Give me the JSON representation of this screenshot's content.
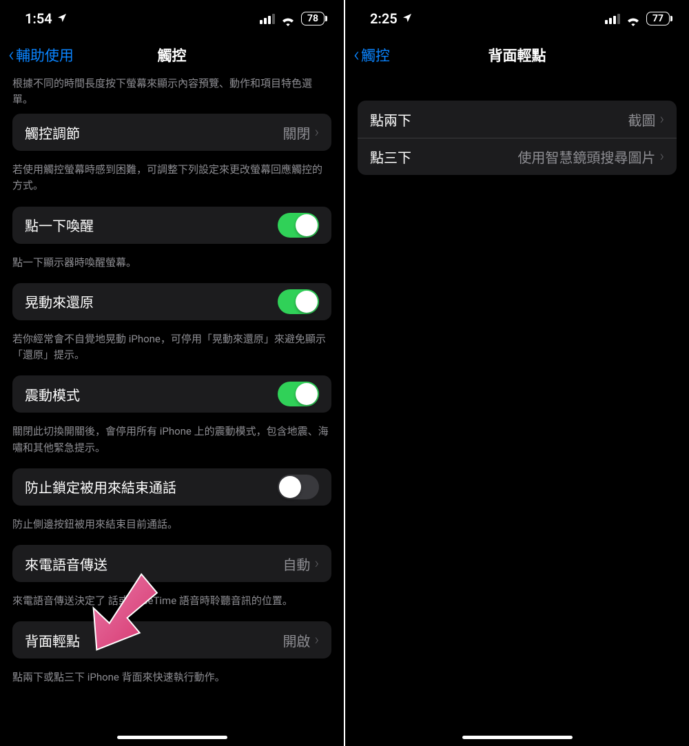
{
  "left": {
    "status": {
      "time": "1:54",
      "battery": "78"
    },
    "nav": {
      "back": "輔助使用",
      "title": "觸控"
    },
    "partialFooter": "根據不同的時間長度按下螢幕來顯示內容預覽、動作和項目特色選單。",
    "rows": {
      "touchAccommodations": {
        "label": "觸控調節",
        "value": "關閉",
        "footer": "若使用觸控螢幕時感到困難，可調整下列設定來更改螢幕回應觸控的方式。"
      },
      "tapToWake": {
        "label": "點一下喚醒",
        "footer": "點一下顯示器時喚醒螢幕。"
      },
      "shakeToUndo": {
        "label": "晃動來還原",
        "footer": "若你經常會不自覺地晃動 iPhone，可停用「晃動來還原」來避免顯示「還原」提示。"
      },
      "vibration": {
        "label": "震動模式",
        "footer": "關閉此切換開關後，會停用所有 iPhone 上的震動模式，包含地震、海嘯和其他緊急提示。"
      },
      "preventLock": {
        "label": "防止鎖定被用來結束通話",
        "footer": "防止側邊按鈕被用來結束目前通話。"
      },
      "callAudio": {
        "label": "來電語音傳送",
        "value": "自動",
        "footer": "來電語音傳送決定了          話或 FaceTime 語音時聆聽音訊的位置。"
      },
      "backTap": {
        "label": "背面輕點",
        "value": "開啟",
        "footer": "點兩下或點三下 iPhone 背面來快速執行動作。"
      }
    }
  },
  "right": {
    "status": {
      "time": "2:25",
      "battery": "77"
    },
    "nav": {
      "back": "觸控",
      "title": "背面輕點"
    },
    "rows": {
      "doubleTap": {
        "label": "點兩下",
        "value": "截圖"
      },
      "tripleTap": {
        "label": "點三下",
        "value": "使用智慧鏡頭搜尋圖片"
      }
    }
  }
}
